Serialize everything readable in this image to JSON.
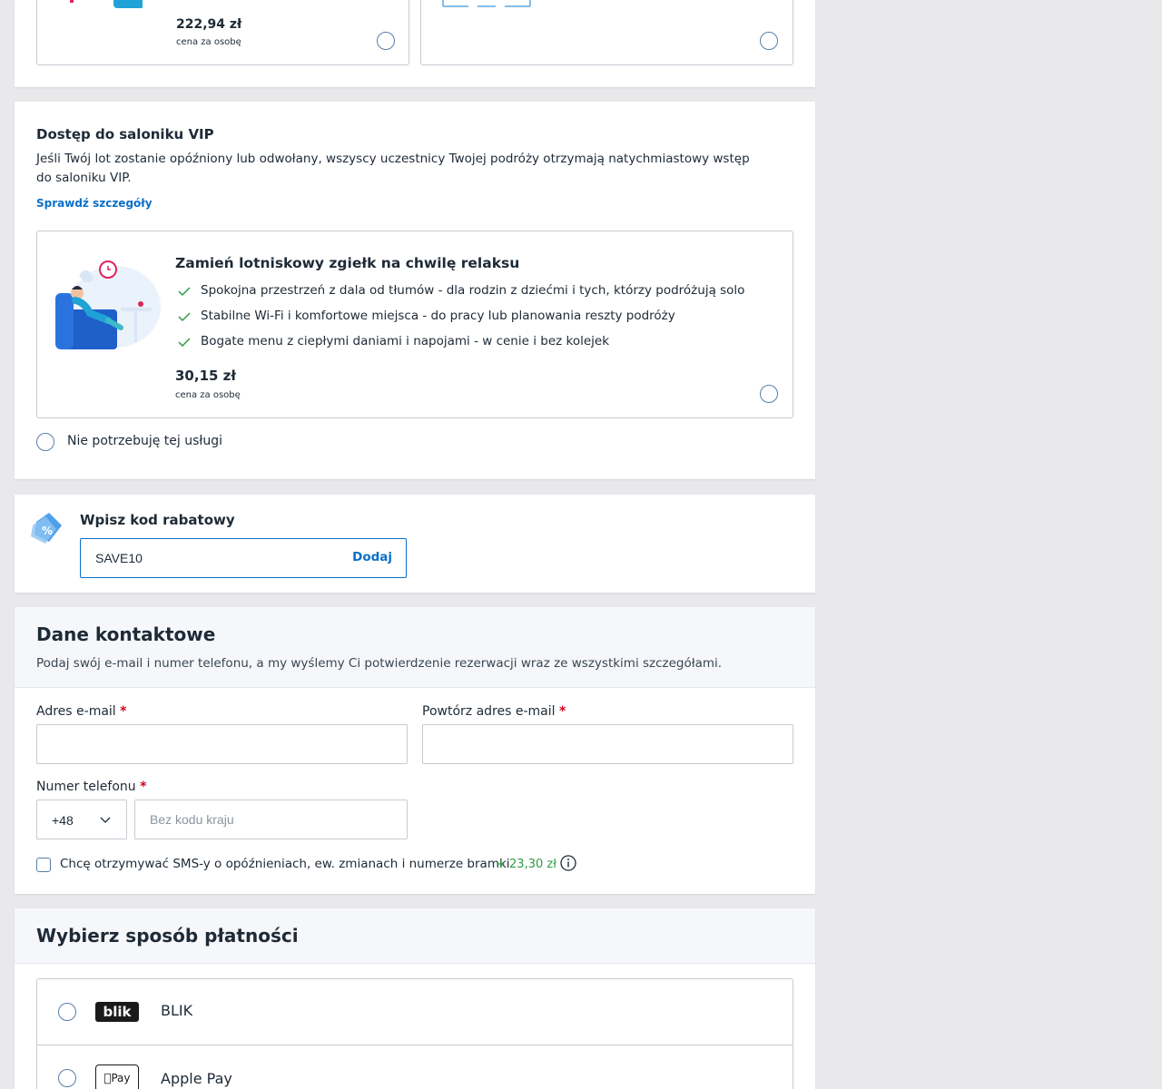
{
  "top_offers": {
    "left": {
      "price": "222,94 zł",
      "price_note": "cena za osobę"
    }
  },
  "vip": {
    "title": "Dostęp do saloniku VIP",
    "description": "Jeśli Twój lot zostanie opóźniony lub odwołany, wszyscy uczestnicy Twojej podróży otrzymają natychmiastowy wstęp do saloniku VIP.",
    "details_link": "Sprawdź szczegóły",
    "offer": {
      "heading": "Zamień lotniskowy zgiełk na chwilę relaksu",
      "benefits": [
        "Spokojna przestrzeń z dala od tłumów - dla rodzin z dziećmi i tych, którzy podróżują solo",
        "Stabilne Wi-Fi i komfortowe miejsca - do pracy lub planowania reszty podróży",
        "Bogate menu z ciepłymi daniami i napojami - w cenie i bez kolejek"
      ],
      "price": "30,15 zł",
      "price_note": "cena za osobę"
    },
    "decline_label": "Nie potrzebuję tej usługi"
  },
  "discount": {
    "title": "Wpisz kod rabatowy",
    "value": "SAVE10",
    "add_label": "Dodaj"
  },
  "contact": {
    "title": "Dane kontaktowe",
    "subtitle": "Podaj swój e-mail i numer telefonu, a my wyślemy Ci potwierdzenie rezerwacji wraz ze wszystkimi szczegółami.",
    "email_label": "Adres e-mail",
    "email_repeat_label": "Powtórz adres e-mail",
    "phone_label": "Numer telefonu",
    "required_mark": "*",
    "country_code": "+48",
    "phone_placeholder": "Bez kodu kraju",
    "sms_label": "Chcę otrzymywać SMS-y o opóźnieniach, ew. zmianach i numerze bramki",
    "sms_price": "+ 23,30 zł"
  },
  "payment": {
    "title": "Wybierz sposób płatności",
    "methods": [
      {
        "label": "BLIK",
        "logo_text": "blik"
      },
      {
        "label": "Apple Pay",
        "logo_text": "Pay"
      }
    ]
  },
  "colors": {
    "accent": "#0b6fc9",
    "success": "#2e9b46",
    "required": "#d0021b",
    "border": "#c6ccd3"
  }
}
